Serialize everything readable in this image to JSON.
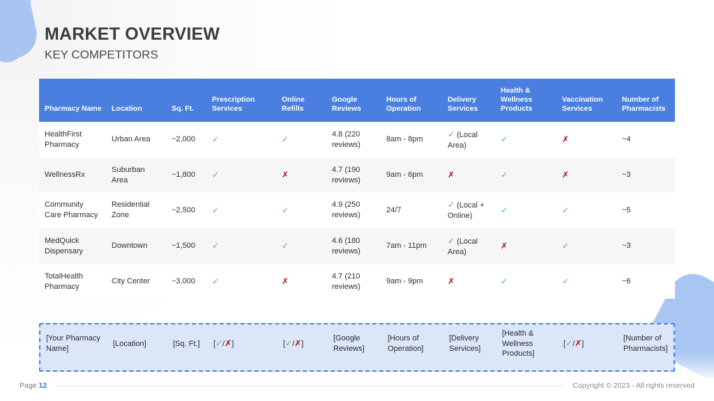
{
  "slide": {
    "title": "MARKET OVERVIEW",
    "subtitle": "KEY COMPETITORS"
  },
  "theme": {
    "header_blue": "#4a7fe0",
    "yes_green": "#3dcc3d",
    "no_red": "#b00b0b",
    "highlight_fill": "#dbe6f9",
    "stripe_gray": "#f6f6f6"
  },
  "table": {
    "columns": [
      "Pharmacy Name",
      "Location",
      "Sq. Ft.",
      "Prescription Services",
      "Online Refills",
      "Google Reviews",
      "Hours of Operation",
      "Delivery Services",
      "Health & Wellness Products",
      "Vaccination Services",
      "Number of Pharmacists"
    ],
    "rows": [
      {
        "name": "HealthFirst Pharmacy",
        "location": "Urban Area",
        "sqft": "~2,000",
        "prescription": "✓",
        "refills": "✓",
        "reviews": "4.8 (220 reviews)",
        "hours": "8am - 8pm",
        "delivery_mark": "✓",
        "delivery_note": "(Local Area)",
        "wellness": "✓",
        "vaccination": "✗",
        "pharmacists": "~4"
      },
      {
        "name": "WellnessRx",
        "location": "Suburban Area",
        "sqft": "~1,800",
        "prescription": "✓",
        "refills": "✗",
        "reviews": "4.7 (190 reviews)",
        "hours": "9am - 6pm",
        "delivery_mark": "✗",
        "delivery_note": "",
        "wellness": "✓",
        "vaccination": "✗",
        "pharmacists": "~3"
      },
      {
        "name": "Community Care Pharmacy",
        "location": "Residential Zone",
        "sqft": "~2,500",
        "prescription": "✓",
        "refills": "✓",
        "reviews": "4.9 (250 reviews)",
        "hours": "24/7",
        "delivery_mark": "✓",
        "delivery_note": "(Local + Online)",
        "wellness": "✓",
        "vaccination": "✓",
        "pharmacists": "~5"
      },
      {
        "name": "MedQuick Dispensary",
        "location": "Downtown",
        "sqft": "~1,500",
        "prescription": "✓",
        "refills": "✓",
        "reviews": "4.6 (180 reviews)",
        "hours": "7am - 11pm",
        "delivery_mark": "✓",
        "delivery_note": "(Local Area)",
        "wellness": "✗",
        "vaccination": "✓",
        "pharmacists": "~3"
      },
      {
        "name": "TotalHealth Pharmacy",
        "location": "City Center",
        "sqft": "~3,000",
        "prescription": "✓",
        "refills": "✗",
        "reviews": "4.7 (210 reviews)",
        "hours": "9am - 9pm",
        "delivery_mark": "✗",
        "delivery_note": "",
        "wellness": "✓",
        "vaccination": "✓",
        "pharmacists": "~6"
      }
    ],
    "template_row": {
      "name": "[Your Pharmacy Name]",
      "location": "[Location]",
      "sqft": "[Sq. Ft.]",
      "prescription_open": "[",
      "prescription_yes": "✓",
      "prescription_sep": "/",
      "prescription_no": "✗",
      "prescription_close": "]",
      "refills_open": "[",
      "refills_yes": "✓",
      "refills_sep": "/",
      "refills_no": "✗",
      "refills_close": "]",
      "reviews": "[Google Reviews]",
      "hours": "[Hours of Operation]",
      "delivery": "[Delivery Services]",
      "wellness": "[Health & Wellness Products]",
      "vaccination_open": "[",
      "vaccination_yes": "✓",
      "vaccination_sep": "/",
      "vaccination_no": "✗",
      "vaccination_close": "]",
      "pharmacists": "[Number of Pharmacists]"
    }
  },
  "footer": {
    "page_label": "Page",
    "page_number": "12",
    "copyright": "Copyright © 2023 - All rights reserved"
  }
}
